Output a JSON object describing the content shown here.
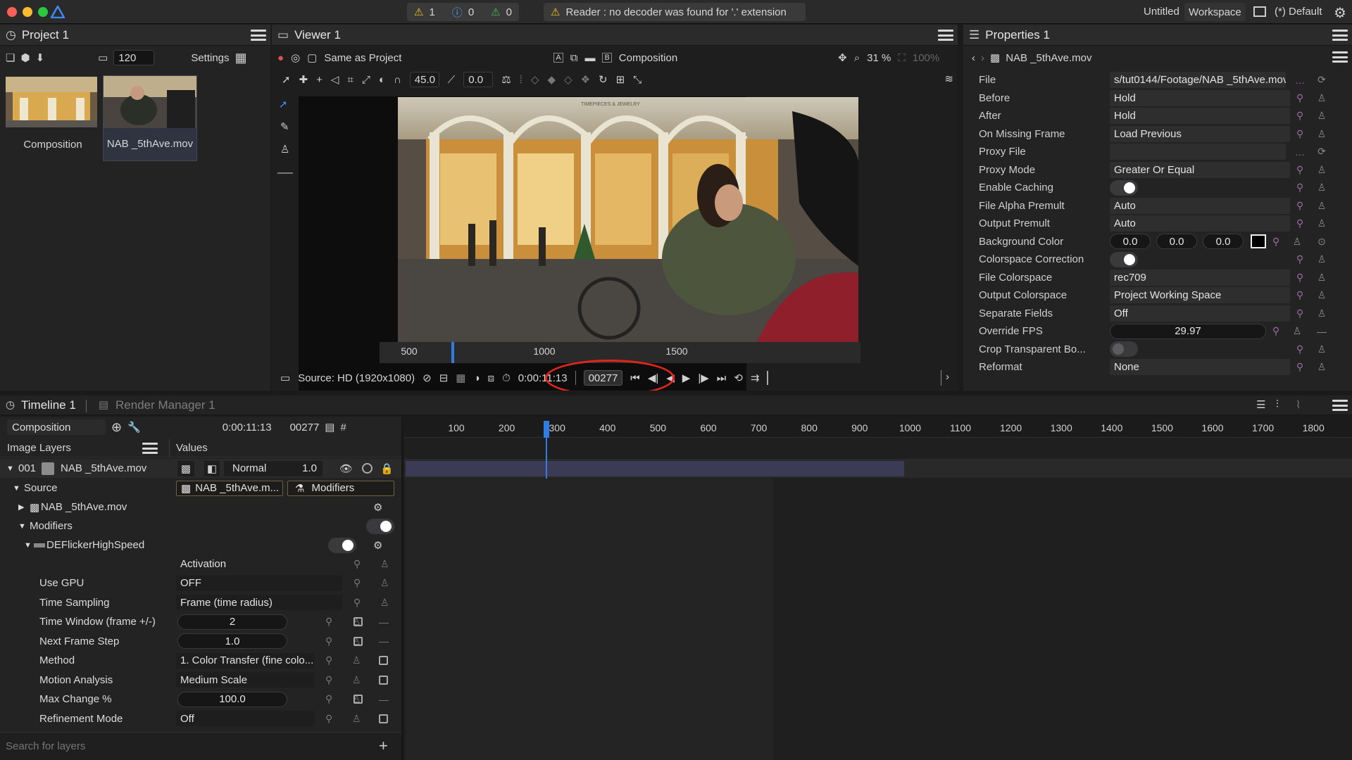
{
  "titlebar": {
    "warnings": "1",
    "infos": "0",
    "notices": "0",
    "message": "Reader : no decoder was found for '.' extension",
    "doc_title": "Untitled",
    "workspace_label": "Workspace",
    "layout": "(*) Default"
  },
  "project": {
    "tab": "Project 1",
    "frames": "120",
    "settings": "Settings",
    "items": [
      {
        "label": "Composition"
      },
      {
        "label": "NAB _5thAve.mov"
      }
    ]
  },
  "viewer": {
    "tab": "Viewer 1",
    "same_as": "Same as Project",
    "view_a": "A",
    "view_b": "B",
    "composition": "Composition",
    "zoom": "31 %",
    "zoom_full": "100%",
    "angle": "45.0",
    "offset": "0.0",
    "ruler": [
      "500",
      "1000",
      "1500"
    ],
    "playhead_fraction": 0.15,
    "source": "Source: HD (1920x1080)",
    "timecode": "0:00:11:13",
    "frame": "00277",
    "image": {
      "store_sign": "TIMEPIECES & JEWELRY"
    }
  },
  "properties": {
    "tab": "Properties 1",
    "item": "NAB _5thAve.mov",
    "rows": [
      {
        "label": "File",
        "value": "s/tut0144/Footage/NAB _5thAve.mov"
      },
      {
        "label": "Before",
        "value": "Hold"
      },
      {
        "label": "After",
        "value": "Hold"
      },
      {
        "label": "On Missing Frame",
        "value": "Load Previous"
      },
      {
        "label": "Proxy File",
        "value": ""
      },
      {
        "label": "Proxy Mode",
        "value": "Greater Or Equal"
      },
      {
        "label": "Enable Caching",
        "value": ""
      },
      {
        "label": "File Alpha Premult",
        "value": "Auto"
      },
      {
        "label": "Output Premult",
        "value": "Auto"
      },
      {
        "label": "Background Color",
        "value": ""
      },
      {
        "label": "Colorspace Correction",
        "value": ""
      },
      {
        "label": "File Colorspace",
        "value": "rec709"
      },
      {
        "label": "Output Colorspace",
        "value": "Project Working Space"
      },
      {
        "label": "Separate Fields",
        "value": "Off"
      },
      {
        "label": "Override FPS",
        "value": ""
      },
      {
        "label": "Crop Transparent Bo...",
        "value": ""
      },
      {
        "label": "Reformat",
        "value": "None"
      }
    ],
    "bg_color": [
      "0.0",
      "0.0",
      "0.0"
    ],
    "fps": "29.97",
    "enable_caching": true,
    "colorspace_correction": true,
    "crop_transparent": false
  },
  "timeline": {
    "tab": "Timeline 1",
    "render_tab": "Render Manager 1",
    "comp": "Composition",
    "timecode": "0:00:11:13",
    "frame": "00277",
    "image_layers": "Image Layers",
    "values": "Values",
    "ruler": [
      "100",
      "200",
      "300",
      "400",
      "500",
      "600",
      "700",
      "800",
      "900",
      "1000",
      "1100",
      "1200",
      "1300",
      "1400",
      "1500",
      "1600",
      "1700",
      "1800"
    ],
    "current_frame": 277,
    "layer": {
      "num": "001",
      "name": "NAB _5thAve.mov",
      "blend": "Normal",
      "opacity": "1.0"
    },
    "source_label": "Source",
    "source_ref": "NAB _5thAve.m...",
    "modifiers_btn": "Modifiers",
    "source_child": "NAB _5thAve.mov",
    "modifiers_label": "Modifiers",
    "modifier_name": "DEFlickerHighSpeed",
    "activation": "Activation",
    "params": [
      {
        "label": "Use GPU",
        "value": "OFF"
      },
      {
        "label": "Time Sampling",
        "value": "Frame (time radius)"
      },
      {
        "label": "Time Window (frame +/-)",
        "value": "2"
      },
      {
        "label": "Next Frame Step",
        "value": "1.0"
      },
      {
        "label": "Method",
        "value": "1. Color Transfer (fine colo..."
      },
      {
        "label": "Motion Analysis",
        "value": "Medium  Scale"
      },
      {
        "label": "Max Change %",
        "value": "100.0"
      },
      {
        "label": "Refinement Mode",
        "value": "Off"
      }
    ],
    "search_placeholder": "Search for layers"
  },
  "colors": {
    "accent": "#2f7de1",
    "annotation": "#e0261b",
    "clip": "#3b3b55",
    "keyicon": "#9a6aa0"
  }
}
